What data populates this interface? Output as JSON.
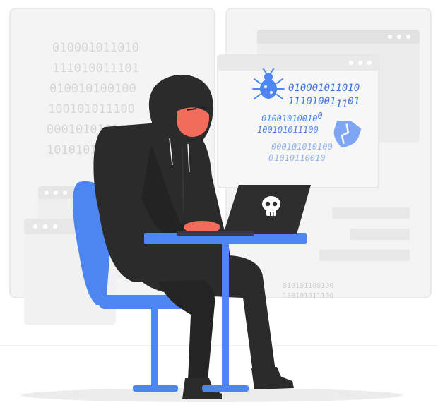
{
  "colors": {
    "panel_bg": "#f4f4f4",
    "panel_border": "#e3e3e3",
    "window_bg": "#ebebeb",
    "window_front": "#f6f6f6",
    "binary_faded": "#dcdcdc",
    "accent_blue": "#4d86f0",
    "accent_blue_light": "#7fa6f3",
    "hoodie": "#2b2b2b",
    "hoodie_shade": "#1f1f1f",
    "skin": "#f26b5b",
    "laptop": "#2e2e2e",
    "floor": "#e6e6e6"
  },
  "background_binary": {
    "lines": [
      "010001011010",
      "111010011101",
      "010010100100",
      "100101011100",
      "000101010101",
      "101010101010"
    ]
  },
  "popup": {
    "bug_binary": [
      "010001011010",
      "11101001",
      "01"
    ],
    "bug_sub": "11",
    "mid_binary": [
      "01001010010",
      "100101011100"
    ],
    "mid_sup": "0",
    "light_binary": [
      "000101010100",
      "1010110010"
    ],
    "light_subs": [
      "0",
      "0"
    ],
    "icons": [
      "bug-icon",
      "broken-shield-icon"
    ]
  },
  "bottom_binary": [
    "010101100100",
    "100101011100"
  ],
  "laptop": {
    "icon": "skull-icon"
  }
}
